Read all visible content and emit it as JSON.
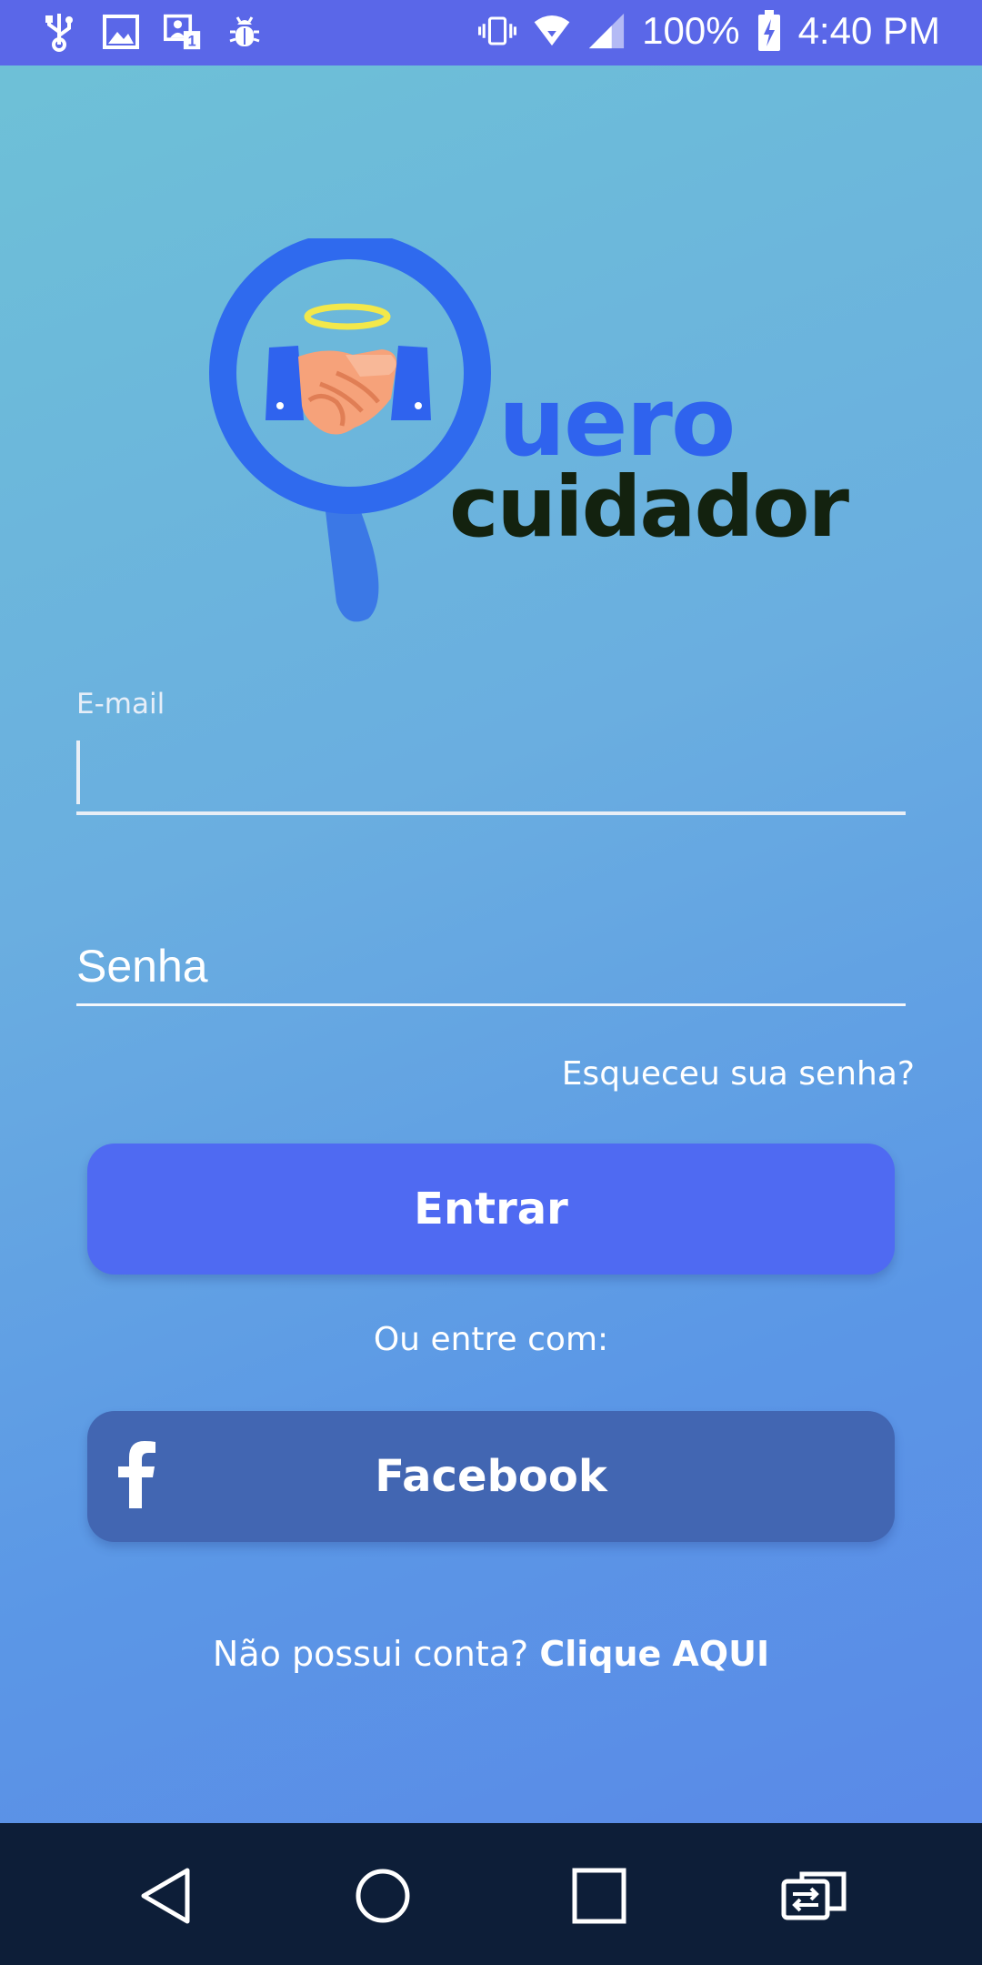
{
  "status_bar": {
    "battery": "100%",
    "time": "4:40 PM",
    "left_icons": [
      "usb-icon",
      "image-icon",
      "notification-icon",
      "bug-icon"
    ],
    "right_icons": [
      "vibrate-icon",
      "wifi-icon",
      "signal-icon",
      "battery-icon"
    ]
  },
  "logo": {
    "word1": "uero",
    "word2": "cuidador",
    "colors": {
      "ring": "#2f63ee",
      "text_dark": "#13220f",
      "halo": "#f3e84a"
    }
  },
  "form": {
    "email_label": "E-mail",
    "email_value": "",
    "password_placeholder": "Senha",
    "forgot_password": "Esqueceu sua senha?",
    "login_button": "Entrar",
    "or_text": "Ou entre com:",
    "facebook_button": "Facebook"
  },
  "signup": {
    "prompt": "Não possui conta?",
    "link1": "Clique",
    "link2": "AQUI"
  },
  "nav": {
    "buttons": [
      "back-icon",
      "home-icon",
      "recents-icon",
      "switch-icon"
    ]
  },
  "colors": {
    "status_bar": "#5a67e8",
    "login_button": "#4f6af2",
    "facebook_button": "#4266b2",
    "nav_bar": "#0d1e38"
  }
}
